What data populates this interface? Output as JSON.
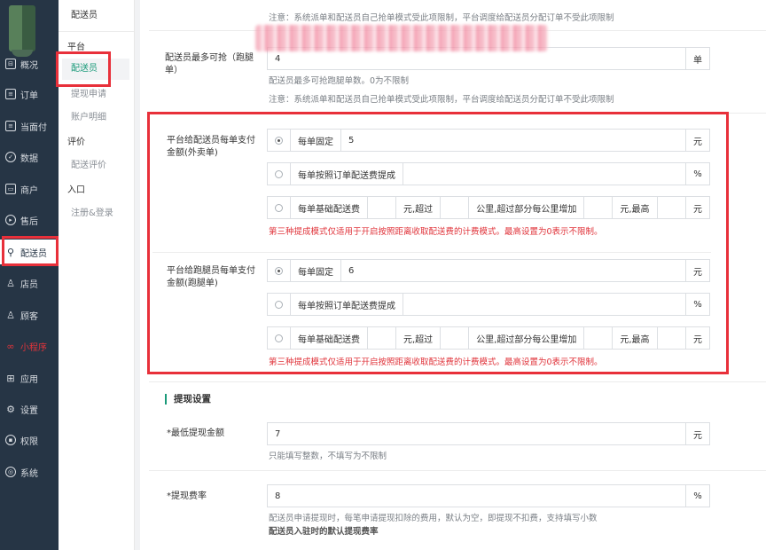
{
  "nav": {
    "items": [
      {
        "label": "概况",
        "icon": "overview-icon",
        "glyph": "☐"
      },
      {
        "label": "订单",
        "icon": "order-icon",
        "glyph": "▤"
      },
      {
        "label": "当面付",
        "icon": "pay-icon",
        "glyph": "▤"
      },
      {
        "label": "数据",
        "icon": "data-icon",
        "glyph": "◔"
      },
      {
        "label": "商户",
        "icon": "shop-icon",
        "glyph": "▣"
      },
      {
        "label": "售后",
        "icon": "aftersale-icon",
        "glyph": "◉"
      },
      {
        "label": "配送员",
        "icon": "courier-icon",
        "glyph": "⚲"
      },
      {
        "label": "店员",
        "icon": "clerk-icon",
        "glyph": "♙"
      },
      {
        "label": "顾客",
        "icon": "customer-icon",
        "glyph": "♙"
      },
      {
        "label": "小程序",
        "icon": "miniprogram-icon",
        "glyph": "∞"
      },
      {
        "label": "应用",
        "icon": "apps-icon",
        "glyph": "⊞"
      },
      {
        "label": "设置",
        "icon": "settings-icon",
        "glyph": "⚙"
      },
      {
        "label": "权限",
        "icon": "permission-icon",
        "glyph": "⚿"
      },
      {
        "label": "系统",
        "icon": "system-icon",
        "glyph": "⊛"
      }
    ]
  },
  "submenu": {
    "header": "配送员",
    "group_platform": "平台",
    "link_courier": "配送员",
    "link_withdraw_apply": "提现申请",
    "link_account_detail": "账户明细",
    "group_review": "评价",
    "link_courier_review": "配送评价",
    "group_entry": "入口",
    "link_register_login": "注册&登录"
  },
  "form": {
    "note_top": "注意：系统派单和配送员自己抢单模式受此项限制，平台调度给配送员分配订单不受此项限制",
    "max_grab_label": "配送员最多可抢（跑腿单）",
    "max_grab_value": "4",
    "max_grab_unit": "单",
    "max_grab_help": "配送员最多可抢跑腿单数。0为不限制",
    "note_mid": "注意：系统派单和配送员自己抢单模式受此项限制，平台调度给配送员分配订单不受此项限制",
    "takeout": {
      "label": "平台给配送员每单支付金额(外卖单)",
      "fixed_label": "每单固定",
      "fixed_value": "5",
      "fixed_unit": "元",
      "percent_label": "每单按照订单配送费提成",
      "percent_value": "",
      "percent_unit": "%",
      "base_label": "每单基础配送费",
      "base_unit_over": "元,超过",
      "km_extra_label": "公里,超过部分每公里增加",
      "max_label": "元,最高",
      "yuan": "元",
      "note": "第三种提成模式仅适用于开启按照距离收取配送费的计费模式。最高设置为0表示不限制。"
    },
    "errand": {
      "label": "平台给跑腿员每单支付金额(跑腿单)",
      "fixed_label": "每单固定",
      "fixed_value": "6",
      "fixed_unit": "元",
      "percent_label": "每单按照订单配送费提成",
      "percent_value": "",
      "percent_unit": "%",
      "base_label": "每单基础配送费",
      "base_unit_over": "元,超过",
      "km_extra_label": "公里,超过部分每公里增加",
      "max_label": "元,最高",
      "yuan": "元",
      "note": "第三种提成模式仅适用于开启按照距离收取配送费的计费模式。最高设置为0表示不限制。"
    },
    "withdraw": {
      "section_title": "提现设置",
      "min_label": "*最低提现金额",
      "min_value": "7",
      "min_unit": "元",
      "min_help": "只能填写整数，不填写为不限制",
      "rate_label": "*提现费率",
      "rate_value": "8",
      "rate_unit": "%",
      "rate_help": "配送员申请提现时，每笔申请提现扣除的费用，默认为空，即提现不扣费，支持填写小数",
      "rate_help2": "配送员入驻时的默认提现费率"
    }
  },
  "colors": {
    "nav_bg": "#263545",
    "accent": "#1a9a79",
    "warning": "#e0343b",
    "annotation": "#e8303a"
  }
}
